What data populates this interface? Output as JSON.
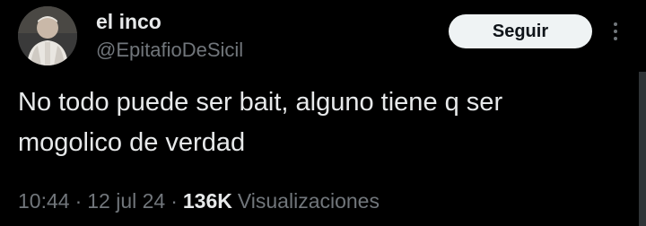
{
  "tweet": {
    "author": {
      "display_name": "el inco",
      "handle": "@EpitafioDeSicil"
    },
    "follow_label": "Seguir",
    "text_lines": [
      "No todo puede ser bait, alguno tiene q ser",
      "mogolico de verdad"
    ],
    "meta": {
      "time": "10:44",
      "separator": "·",
      "date": "12 jul 24",
      "views_count": "136K",
      "views_label": "Visualizaciones"
    }
  },
  "colors": {
    "background": "#000000",
    "primary_text": "#e7e9ea",
    "secondary_text": "#71767b",
    "follow_button_bg": "#eff3f4",
    "follow_button_text": "#0f1419"
  },
  "icons": {
    "more": "more-vertical-icon",
    "avatar": "avatar"
  }
}
